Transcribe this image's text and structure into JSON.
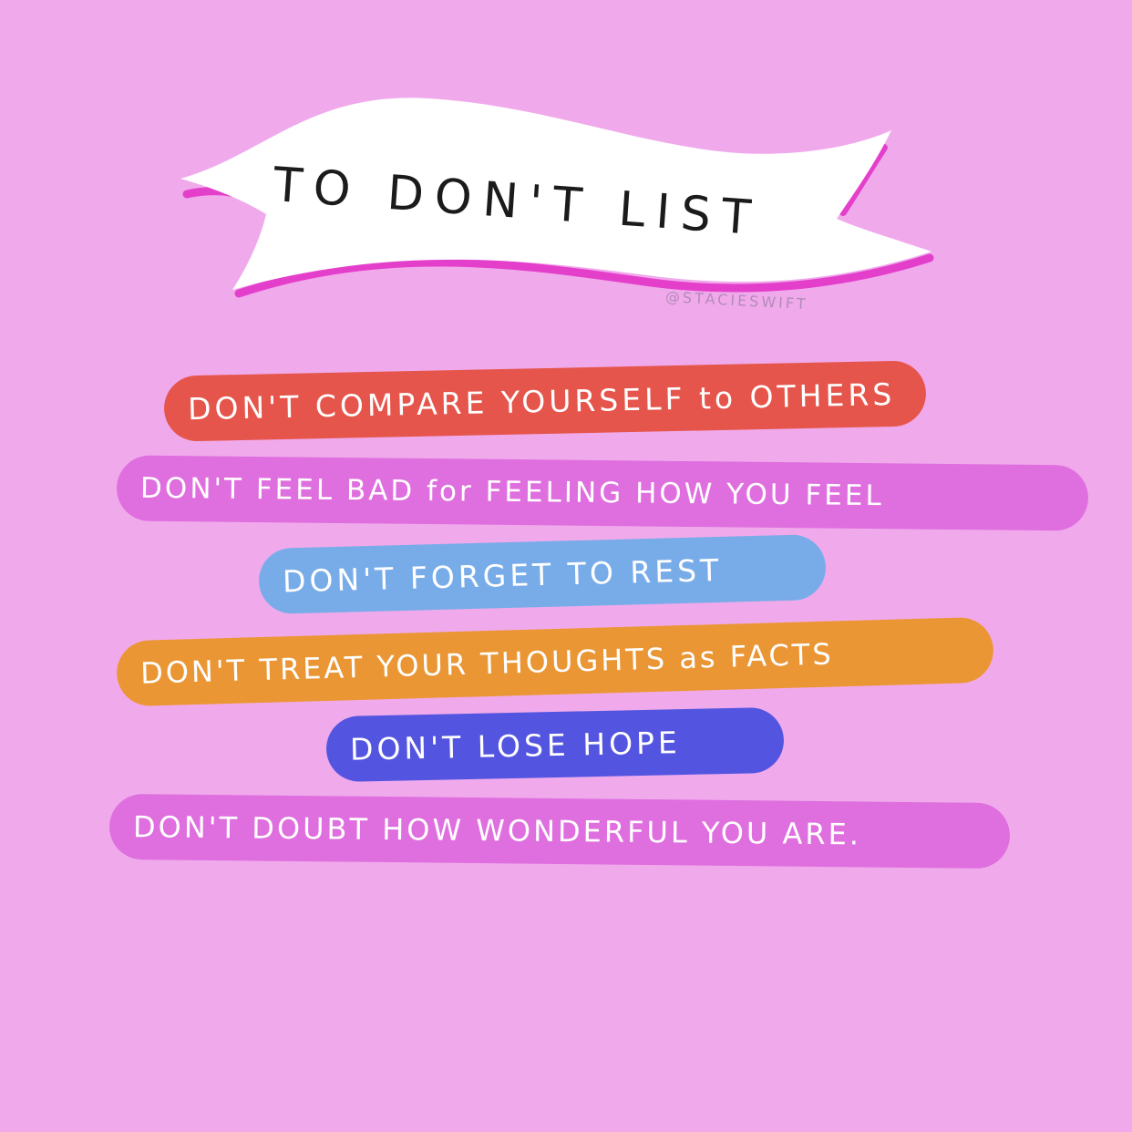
{
  "title": "TO DON'T LIST",
  "credit": "@STACIESWIFT",
  "items": [
    {
      "text": "DON'T COMPARE YOURSELF to OTHERS",
      "color": "#e5554b"
    },
    {
      "text": "DON'T FEEL BAD for FEELING HOW YOU FEEL",
      "color": "#df6fdf"
    },
    {
      "text": "DON'T FORGET TO REST",
      "color": "#78ace8"
    },
    {
      "text": "DON'T TREAT YOUR THOUGHTS as FACTS",
      "color": "#eb9634"
    },
    {
      "text": "DON'T LOSE HOPE",
      "color": "#5355e0"
    },
    {
      "text": "DON'T DOUBT HOW WONDERFUL YOU ARE.",
      "color": "#df6fdf"
    }
  ],
  "colors": {
    "background": "#f0aaec",
    "banner": "#ffffff",
    "banner_shadow": "#e43fcb",
    "text_dark": "#1b1b1b",
    "text_light": "#ffffff"
  },
  "icons": {
    "banner": "ribbon-banner"
  }
}
